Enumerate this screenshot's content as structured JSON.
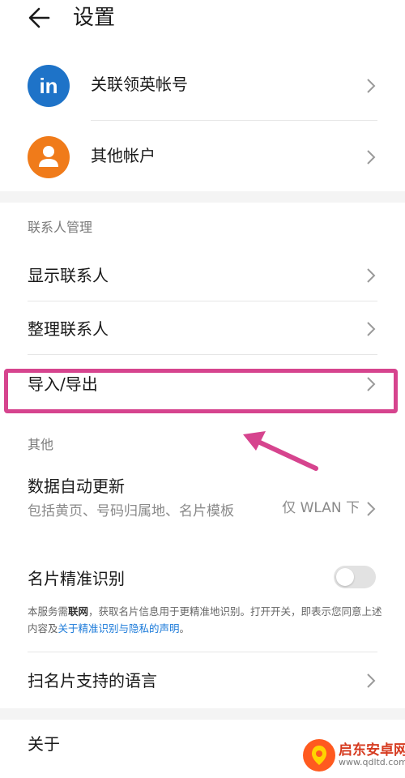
{
  "header": {
    "title": "设置"
  },
  "accounts": [
    {
      "label": "关联领英帐号",
      "avatar_text": "in",
      "color": "#1e73c8"
    },
    {
      "label": "其他帐户",
      "color": "#f07b1a"
    }
  ],
  "contacts_section": {
    "title": "联系人管理",
    "items": [
      {
        "label": "显示联系人"
      },
      {
        "label": "整理联系人"
      },
      {
        "label": "导入/导出"
      }
    ]
  },
  "others_section": {
    "title": "其他",
    "auto_update": {
      "label": "数据自动更新",
      "subtitle": "包括黄页、号码归属地、名片模板",
      "value": "仅 WLAN 下"
    },
    "card_recognition": {
      "label": "名片精准识别",
      "enabled": false,
      "notice_prefix": "本服务需",
      "notice_bold": "联网",
      "notice_middle": "，获取名片信息用于更精准地识别。打开开关，即表示您同意上述内容及",
      "notice_link": "关于精准识别与隐私的声明",
      "notice_suffix": "。"
    },
    "scan_languages": {
      "label": "扫名片支持的语言"
    }
  },
  "about": {
    "label": "关于"
  },
  "watermark": {
    "name": "启东安卓网",
    "url": "www.qdltd.com"
  },
  "colors": {
    "highlight": "#d6448e",
    "link": "#1b7ad9"
  }
}
